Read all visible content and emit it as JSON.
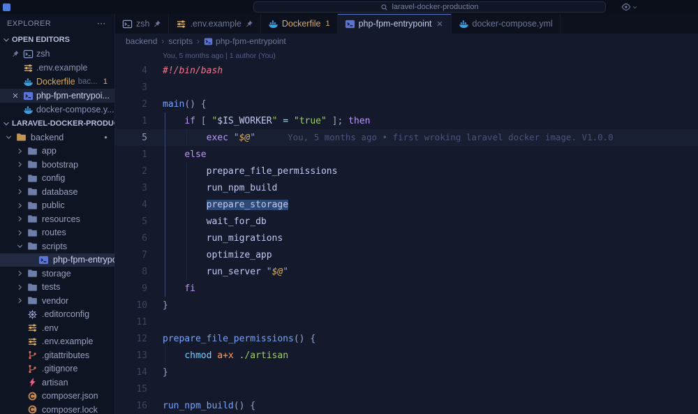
{
  "colors": {
    "accent": "#7aa2f7",
    "warning": "#e0af68",
    "selection": "#2c4875",
    "editor_bg": "#141a2b",
    "sidebar_bg": "#0f1422",
    "titlebar_bg": "#0b0f1a"
  },
  "titlebar": {
    "command_center": "laravel-docker-production"
  },
  "explorer": {
    "title": "EXPLORER",
    "more_label": "⋯",
    "open_editors": {
      "label": "OPEN EDITORS",
      "items": [
        {
          "label": "zsh",
          "icon": "terminal",
          "pinned": true
        },
        {
          "label": ".env.example",
          "icon": "env"
        },
        {
          "label": "Dockerfile",
          "desc": "bac...",
          "badge": "1",
          "icon": "docker",
          "warn": true
        },
        {
          "label": "php-fpm-entrypoi...",
          "icon": "shell",
          "active": true
        },
        {
          "label": "docker-compose.y...",
          "icon": "docker"
        }
      ]
    },
    "workspace": {
      "label": "LARAVEL-DOCKER-PRODUCTI...",
      "tree": [
        {
          "label": "backend",
          "kind": "folder",
          "indent": 0,
          "expanded": true,
          "color": "backend",
          "dot": true
        },
        {
          "label": "app",
          "kind": "folder",
          "indent": 1
        },
        {
          "label": "bootstrap",
          "kind": "folder",
          "indent": 1
        },
        {
          "label": "config",
          "kind": "folder",
          "indent": 1
        },
        {
          "label": "database",
          "kind": "folder",
          "indent": 1
        },
        {
          "label": "public",
          "kind": "folder",
          "indent": 1
        },
        {
          "label": "resources",
          "kind": "folder",
          "indent": 1
        },
        {
          "label": "routes",
          "kind": "folder",
          "indent": 1
        },
        {
          "label": "scripts",
          "kind": "folder",
          "indent": 1,
          "expanded": true
        },
        {
          "label": "php-fpm-entrypo...",
          "kind": "file",
          "icon": "shell",
          "indent": 2,
          "selected": true
        },
        {
          "label": "storage",
          "kind": "folder",
          "indent": 1
        },
        {
          "label": "tests",
          "kind": "folder",
          "indent": 1
        },
        {
          "label": "vendor",
          "kind": "folder",
          "indent": 1
        },
        {
          "label": ".editorconfig",
          "kind": "file",
          "icon": "gear",
          "indent": 1
        },
        {
          "label": ".env",
          "kind": "file",
          "icon": "env",
          "indent": 1
        },
        {
          "label": ".env.example",
          "kind": "file",
          "icon": "env",
          "indent": 1
        },
        {
          "label": ".gitattributes",
          "kind": "file",
          "icon": "git",
          "indent": 1
        },
        {
          "label": ".gitignore",
          "kind": "file",
          "icon": "git",
          "indent": 1
        },
        {
          "label": "artisan",
          "kind": "file",
          "icon": "bolt",
          "indent": 1
        },
        {
          "label": "composer.json",
          "kind": "file",
          "icon": "composer",
          "indent": 1
        },
        {
          "label": "composer.lock",
          "kind": "file",
          "icon": "composer",
          "indent": 1
        }
      ]
    }
  },
  "tabs": [
    {
      "label": "zsh",
      "icon": "terminal",
      "pinned": true
    },
    {
      "label": ".env.example",
      "icon": "env",
      "pinned": true
    },
    {
      "label": "Dockerfile",
      "icon": "docker",
      "badge": "1",
      "warn": true
    },
    {
      "label": "php-fpm-entrypoint",
      "icon": "shell",
      "active": true
    },
    {
      "label": "docker-compose.yml",
      "icon": "docker"
    }
  ],
  "breadcrumbs": {
    "separator": "›",
    "items": [
      {
        "label": "backend"
      },
      {
        "label": "scripts"
      },
      {
        "label": "php-fpm-entrypoint",
        "icon": "shell"
      }
    ]
  },
  "editor": {
    "codelens": "You, 5 months ago | 1 author (You)",
    "blame": "You, 5 months ago • first wroking laravel docker image. V1.0.0",
    "lines": [
      {
        "num": "4",
        "tokens": [
          [
            "#!/bin/bash",
            "sheb"
          ]
        ]
      },
      {
        "num": "3",
        "tokens": []
      },
      {
        "num": "2",
        "tokens": [
          [
            "main",
            "fn"
          ],
          [
            "() {",
            "pn"
          ]
        ]
      },
      {
        "num": "1",
        "tokens": [
          [
            "    ",
            "pn"
          ],
          [
            "if",
            "kw"
          ],
          [
            " [ ",
            "pn"
          ],
          [
            "\"",
            "str"
          ],
          [
            "$IS_WORKER",
            "var"
          ],
          [
            "\"",
            "str"
          ],
          [
            " ",
            "pn"
          ],
          [
            "=",
            "op"
          ],
          [
            " ",
            "pn"
          ],
          [
            "\"true\"",
            "str"
          ],
          [
            " ];",
            "pn"
          ],
          [
            " ",
            "pn"
          ],
          [
            "then",
            "kw"
          ]
        ]
      },
      {
        "num": "5",
        "current": true,
        "blame": true,
        "tokens": [
          [
            "        ",
            "pn"
          ],
          [
            "exec",
            "kw"
          ],
          [
            " ",
            "pn"
          ],
          [
            "\"",
            "pn"
          ],
          [
            "$@",
            "sv"
          ],
          [
            "\"",
            "pn"
          ]
        ]
      },
      {
        "num": "1",
        "tokens": [
          [
            "    ",
            "pn"
          ],
          [
            "else",
            "kw"
          ]
        ]
      },
      {
        "num": "2",
        "tokens": [
          [
            "        ",
            "pn"
          ],
          [
            "prepare_file_permissions",
            "call"
          ]
        ]
      },
      {
        "num": "3",
        "tokens": [
          [
            "        ",
            "pn"
          ],
          [
            "run_npm_build",
            "call"
          ]
        ]
      },
      {
        "num": "4",
        "tokens": [
          [
            "        ",
            "pn"
          ],
          [
            "prepare_storage",
            "call sel"
          ]
        ]
      },
      {
        "num": "5",
        "tokens": [
          [
            "        ",
            "pn"
          ],
          [
            "wait_for_db",
            "call"
          ]
        ]
      },
      {
        "num": "6",
        "tokens": [
          [
            "        ",
            "pn"
          ],
          [
            "run_migrations",
            "call"
          ]
        ]
      },
      {
        "num": "7",
        "tokens": [
          [
            "        ",
            "pn"
          ],
          [
            "optimize_app",
            "call"
          ]
        ]
      },
      {
        "num": "8",
        "tokens": [
          [
            "        ",
            "pn"
          ],
          [
            "run_server",
            "call"
          ],
          [
            " ",
            "pn"
          ],
          [
            "\"",
            "pn"
          ],
          [
            "$@",
            "sv"
          ],
          [
            "\"",
            "pn"
          ]
        ]
      },
      {
        "num": "9",
        "tokens": [
          [
            "    ",
            "pn"
          ],
          [
            "fi",
            "kw"
          ]
        ]
      },
      {
        "num": "10",
        "tokens": [
          [
            "}",
            "pn"
          ]
        ]
      },
      {
        "num": "11",
        "tokens": []
      },
      {
        "num": "12",
        "tokens": [
          [
            "prepare_file_permissions",
            "fn"
          ],
          [
            "() {",
            "pn"
          ]
        ]
      },
      {
        "num": "13",
        "tokens": [
          [
            "    ",
            "pn"
          ],
          [
            "chmod",
            "cmd"
          ],
          [
            " ",
            "pn"
          ],
          [
            "a+x",
            "flag"
          ],
          [
            " ",
            "pn"
          ],
          [
            "./artisan",
            "str"
          ]
        ]
      },
      {
        "num": "14",
        "tokens": [
          [
            "}",
            "pn"
          ]
        ]
      },
      {
        "num": "15",
        "tokens": []
      },
      {
        "num": "16",
        "tokens": [
          [
            "run_npm_build",
            "fn"
          ],
          [
            "() {",
            "pn"
          ]
        ]
      }
    ]
  }
}
